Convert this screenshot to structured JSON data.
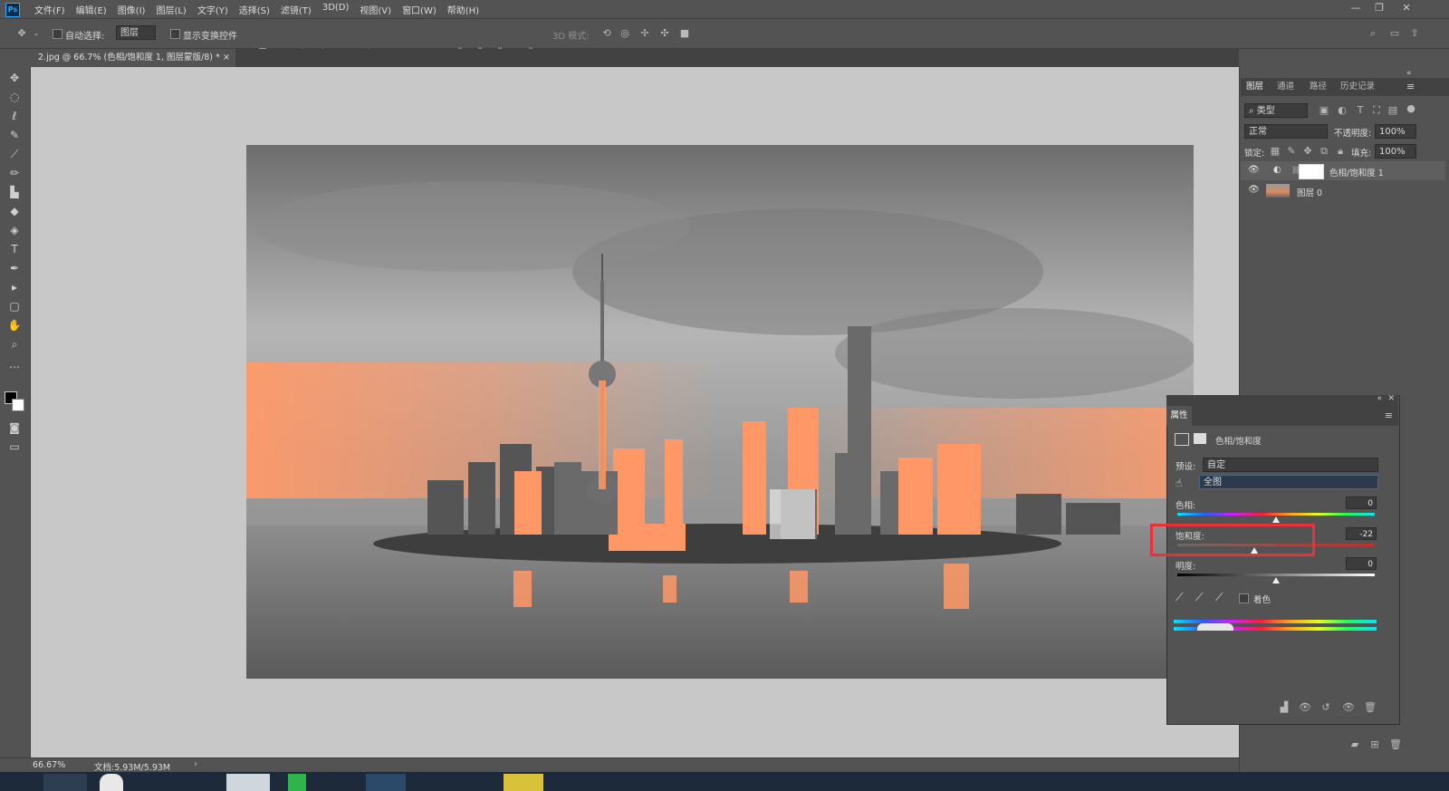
{
  "menubar": {
    "logo": "Ps",
    "items": [
      "文件(F)",
      "编辑(E)",
      "图像(I)",
      "图层(L)",
      "文字(Y)",
      "选择(S)",
      "滤镜(T)",
      "3D(D)",
      "视图(V)",
      "窗口(W)",
      "帮助(H)"
    ]
  },
  "options": {
    "auto_select_label": "自动选择:",
    "auto_select_value": "图层",
    "show_transform_label": "显示变换控件",
    "mode_3d_label": "3D 模式:"
  },
  "document": {
    "tab_title": "2.jpg @ 66.7% (色相/饱和度 1, 图层蒙版/8) *"
  },
  "status": {
    "zoom": "66.67%",
    "doc_size": "文档:5.93M/5.93M"
  },
  "layers_panel": {
    "tabs": [
      "图层",
      "通道",
      "路径",
      "历史记录"
    ],
    "filter_kind": "类型",
    "blend_mode": "正常",
    "opacity_label": "不透明度:",
    "opacity_value": "100%",
    "lock_label": "锁定:",
    "fill_label": "填充:",
    "fill_value": "100%",
    "layers": [
      {
        "name": "色相/饱和度 1",
        "type": "adjustment",
        "visible": true
      },
      {
        "name": "图层 0",
        "type": "image",
        "visible": true
      }
    ]
  },
  "properties_panel": {
    "tab": "属性",
    "title": "色相/饱和度",
    "preset_label": "预设:",
    "preset_value": "自定",
    "channel_value": "全图",
    "hue_label": "色相:",
    "hue_value": "0",
    "saturation_label": "饱和度:",
    "saturation_value": "-22",
    "lightness_label": "明度:",
    "lightness_value": "0",
    "colorize_label": "着色",
    "saturation_fraction": 0.39,
    "hue_fraction": 0.5,
    "lightness_fraction": 0.5
  },
  "colors": {
    "highlight": "#e8323a",
    "panel_bg": "#535353",
    "canvas_bg": "#c8c8c8"
  }
}
